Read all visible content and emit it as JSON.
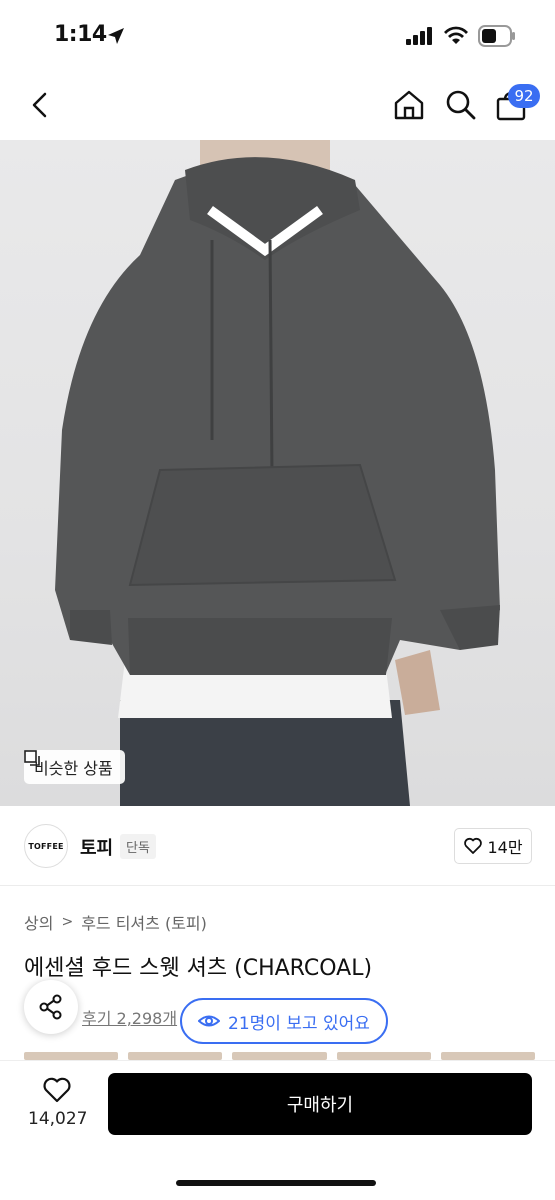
{
  "status": {
    "time": "1:14"
  },
  "nav": {
    "cart_count": "92"
  },
  "hero": {
    "similar_label": "비슷한 상품"
  },
  "brand": {
    "logo_text": "TOFFEE",
    "name": "토피",
    "tag": "단독",
    "likes": "14만"
  },
  "product": {
    "breadcrumb": [
      "상의",
      "후드 티셔츠 (토피)"
    ],
    "title": "에센셜 후드 스웻 셔츠 (CHARCOAL)",
    "review_link": "후기 2,298개",
    "viewers": "21명이 보고 있어요"
  },
  "bottom": {
    "wish_count": "14,027",
    "buy_label": "구매하기"
  },
  "colors": {
    "accent": "#3a6ef2",
    "buy": "#000000",
    "hoodie": "#555657"
  }
}
